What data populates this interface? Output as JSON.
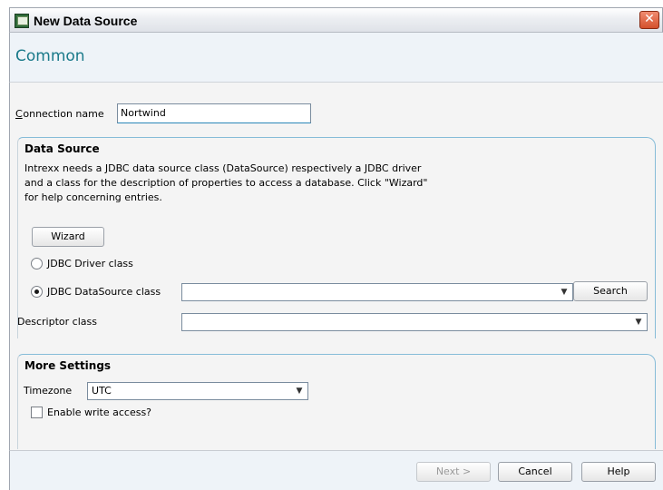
{
  "window": {
    "title": "New Data Source",
    "close_glyph": "✕"
  },
  "page": {
    "heading": "Common"
  },
  "connection": {
    "label": "Connection name",
    "value": "Nortwind"
  },
  "data_source": {
    "title": "Data Source",
    "description": "Intrexx needs a JDBC data source class (DataSource) respectively a JDBC driver and a class for the description of properties to access a database. Click \"Wizard\" for help concerning entries.",
    "wizard_label": "Wizard",
    "driver_label": "JDBC Driver class",
    "datasource_label": "JDBC DataSource class",
    "datasource_value": "",
    "search_label": "Search",
    "descriptor_label": "Descriptor class",
    "descriptor_value": "",
    "selected": "datasource"
  },
  "more_settings": {
    "title": "More Settings",
    "timezone_label": "Timezone",
    "timezone_value": "UTC",
    "write_access_label": "Enable write access?",
    "write_access_checked": false
  },
  "footer": {
    "next_label": "Next >",
    "cancel_label": "Cancel",
    "help_label": "Help"
  },
  "icons": {
    "dropdown_arrow": "chevron-down-icon",
    "app": "data-source-app-icon"
  }
}
